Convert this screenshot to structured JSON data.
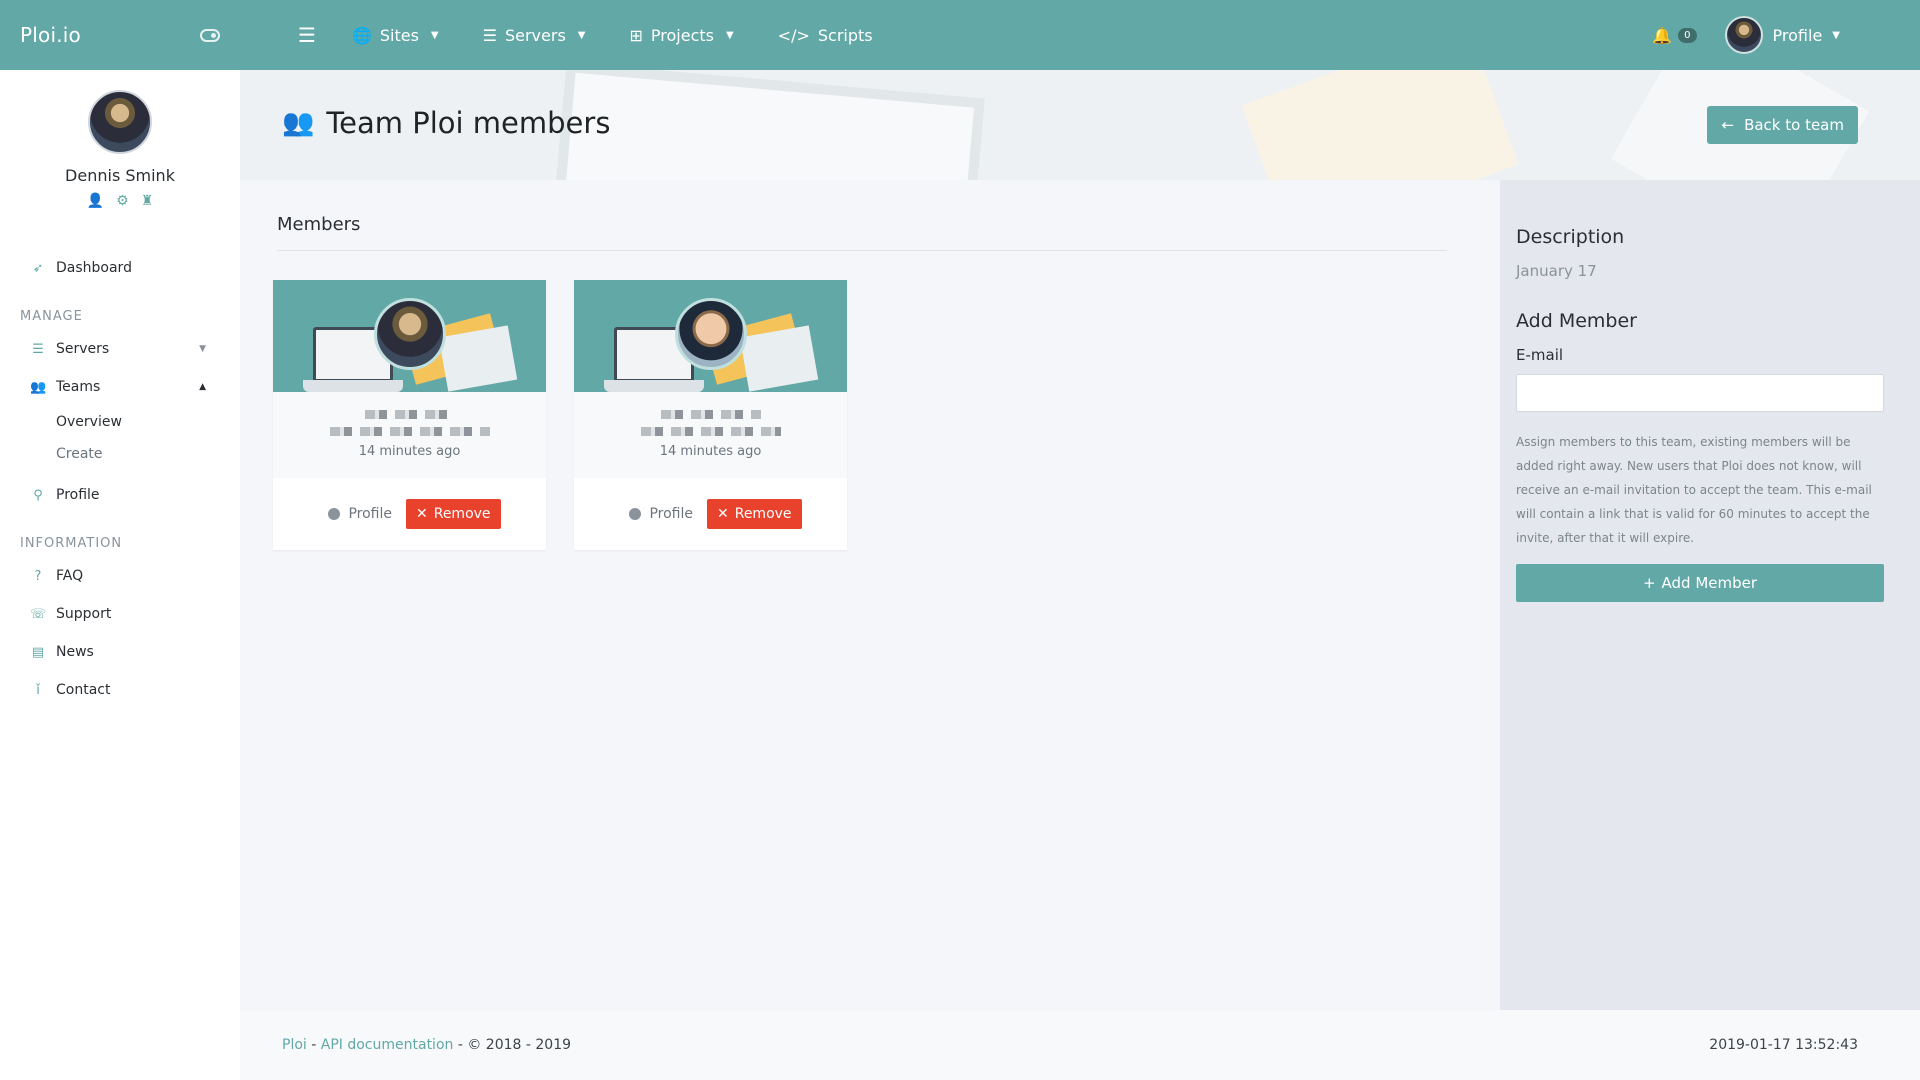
{
  "brand": {
    "name": "Ploi.io"
  },
  "user": {
    "name": "Dennis Smink"
  },
  "sidebar": {
    "dashboard": "Dashboard",
    "manage_heading": "MANAGE",
    "servers": "Servers",
    "teams": "Teams",
    "teams_sub": [
      "Overview",
      "Create"
    ],
    "profile": "Profile",
    "info_heading": "INFORMATION",
    "faq": "FAQ",
    "support": "Support",
    "news": "News",
    "contact": "Contact"
  },
  "topbar": {
    "sites": "Sites",
    "servers": "Servers",
    "projects": "Projects",
    "scripts": "Scripts",
    "notification_count": "0",
    "profile": "Profile"
  },
  "header": {
    "title": "Team Ploi members",
    "back_button": "Back to team"
  },
  "members": {
    "title": "Members",
    "cards": [
      {
        "time": "14 minutes ago",
        "profile_label": "Profile",
        "remove_label": "Remove"
      },
      {
        "time": "14 minutes ago",
        "profile_label": "Profile",
        "remove_label": "Remove"
      }
    ]
  },
  "panel": {
    "description_title": "Description",
    "description_text": "January 17",
    "add_title": "Add Member",
    "email_label": "E-mail",
    "email_value": "",
    "help_text": "Assign members to this team, existing members will be added right away. New users that Ploi does not know, will receive an e-mail invitation to accept the team. This e-mail will contain a link that is valid for 60 minutes to accept the invite, after that it will expire.",
    "add_button": "Add Member"
  },
  "footer": {
    "brand_link": "Ploi",
    "sep1": " - ",
    "api_link": "API documentation",
    "copyright": " - © 2018 - 2019",
    "timestamp": "2019-01-17 13:52:43"
  },
  "colors": {
    "accent": "#62a8a6",
    "danger": "#e8412c"
  }
}
